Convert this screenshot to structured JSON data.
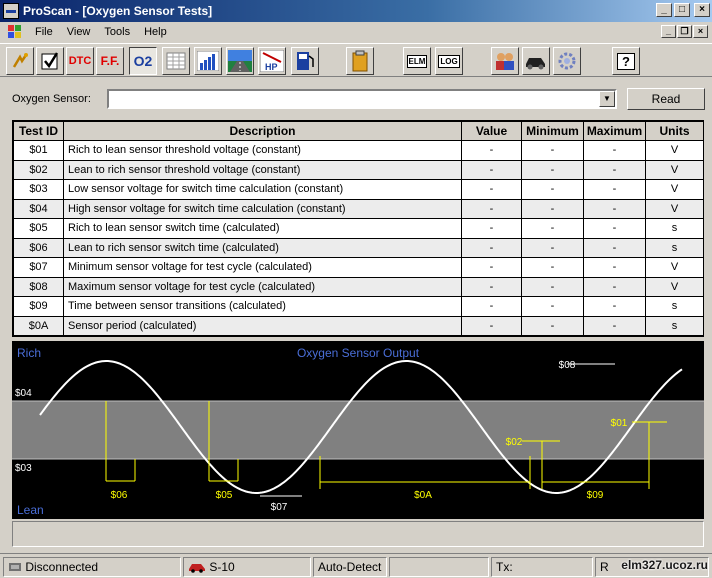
{
  "window": {
    "title": "ProScan - [Oxygen Sensor Tests]"
  },
  "menu": {
    "items": [
      "File",
      "View",
      "Tools",
      "Help"
    ]
  },
  "toolbar": {
    "buttons": [
      "monitor",
      "check",
      "dtc",
      "freeze-frame",
      "o2-sensor",
      "table",
      "bar-graph",
      "road",
      "horsepower",
      "fuel",
      "clipboard",
      "elm",
      "log",
      "users",
      "car",
      "settings",
      "help"
    ],
    "dtc_label": "DTC",
    "ff_label": "F.F.",
    "o2_label": "O2",
    "elm_label": "ELM",
    "log_label": "LOG",
    "hp_label": "HP",
    "help_label": "?"
  },
  "sensor": {
    "label": "Oxygen Sensor:",
    "value": "",
    "read_button": "Read"
  },
  "table": {
    "headers": [
      "Test ID",
      "Description",
      "Value",
      "Minimum",
      "Maximum",
      "Units"
    ],
    "rows": [
      [
        "$01",
        "Rich to lean sensor threshold voltage (constant)",
        "-",
        "-",
        "-",
        "V"
      ],
      [
        "$02",
        "Lean to rich sensor threshold voltage (constant)",
        "-",
        "-",
        "-",
        "V"
      ],
      [
        "$03",
        "Low sensor voltage for switch time calculation (constant)",
        "-",
        "-",
        "-",
        "V"
      ],
      [
        "$04",
        "High sensor voltage for switch time calculation (constant)",
        "-",
        "-",
        "-",
        "V"
      ],
      [
        "$05",
        "Rich to lean sensor switch time (calculated)",
        "-",
        "-",
        "-",
        "s"
      ],
      [
        "$06",
        "Lean to rich sensor switch time (calculated)",
        "-",
        "-",
        "-",
        "s"
      ],
      [
        "$07",
        "Minimum sensor voltage for test cycle (calculated)",
        "-",
        "-",
        "-",
        "V"
      ],
      [
        "$08",
        "Maximum sensor voltage for test cycle (calculated)",
        "-",
        "-",
        "-",
        "V"
      ],
      [
        "$09",
        "Time between sensor transitions (calculated)",
        "-",
        "-",
        "-",
        "s"
      ],
      [
        "$0A",
        "Sensor period (calculated)",
        "-",
        "-",
        "-",
        "s"
      ]
    ]
  },
  "chart": {
    "title": "Oxygen Sensor Output",
    "rich_label": "Rich",
    "lean_label": "Lean",
    "level_labels": {
      "high": "$04",
      "low": "$03"
    },
    "annotations": [
      "$06",
      "$05",
      "$07",
      "$0A",
      "$08",
      "$02",
      "$01",
      "$09"
    ],
    "colors": {
      "background": "#000000",
      "band": "#808080",
      "curve": "#ffffff",
      "annotation": "#ffff00",
      "title": "#4a6ed8"
    }
  },
  "status": {
    "connection": "Disconnected",
    "vehicle": "S-10",
    "protocol": "Auto-Detect",
    "tx": "Tx:",
    "rx": "R",
    "watermark": "elm327.ucoz.ru"
  }
}
